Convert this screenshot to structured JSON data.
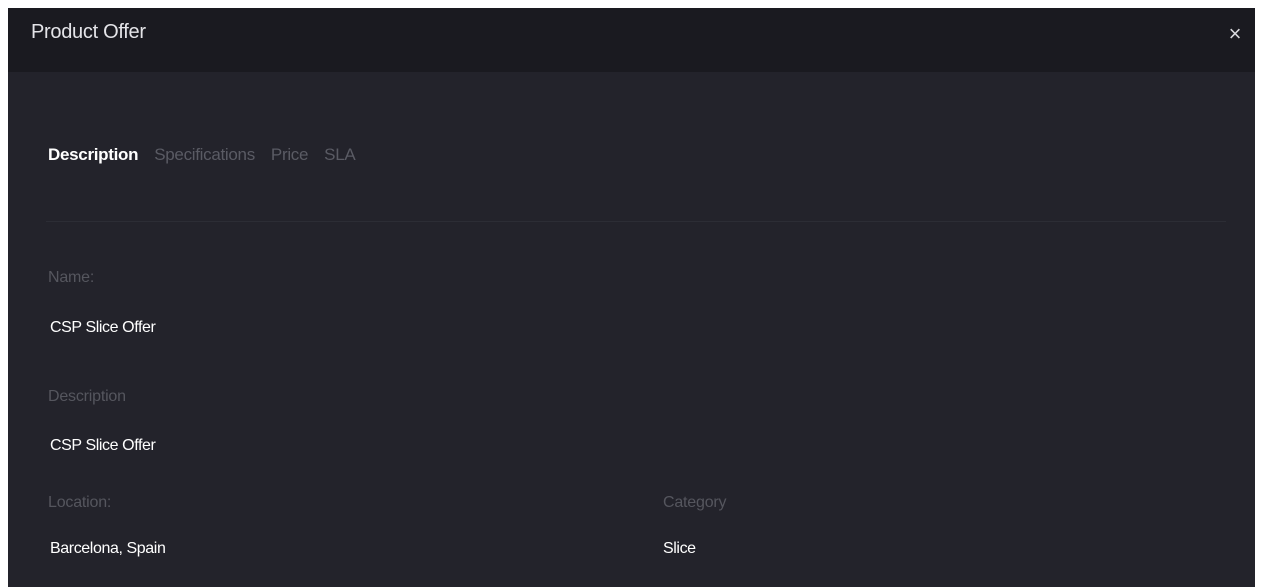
{
  "modal": {
    "title": "Product Offer",
    "close_label": "×"
  },
  "tabs": [
    {
      "label": "Description",
      "active": true
    },
    {
      "label": "Specifications",
      "active": false
    },
    {
      "label": "Price",
      "active": false
    },
    {
      "label": "SLA",
      "active": false
    }
  ],
  "fields": {
    "name": {
      "label": "Name:",
      "value": "CSP Slice Offer"
    },
    "description": {
      "label": "Description",
      "value": "CSP Slice Offer"
    },
    "location": {
      "label": "Location:",
      "value": "Barcelona, Spain"
    },
    "category": {
      "label": "Category",
      "value": "Slice"
    }
  },
  "colors": {
    "modal_background": "#23232b",
    "header_background": "#1a1a20",
    "active_tab": "#ffffff",
    "inactive_tab": "#5a5b64",
    "label": "#55565e",
    "value": "#ffffff"
  }
}
